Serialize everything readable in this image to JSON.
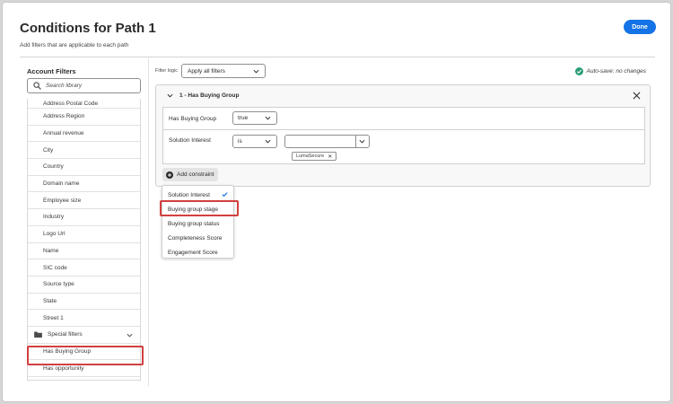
{
  "dialog": {
    "title": "Conditions for Path 1",
    "subtitle": "Add filters that are applicable to each path",
    "done_label": "Done"
  },
  "left_panel": {
    "title": "Account Filters",
    "search_placeholder": "Search library",
    "items": [
      "Address Postal Code",
      "Address Region",
      "Annual revenue",
      "City",
      "Country",
      "Domain name",
      "Employee size",
      "Industry",
      "Logo Url",
      "Name",
      "SIC code",
      "Source type",
      "State",
      "Street 1"
    ],
    "folder_label": "Special filters",
    "special_items": [
      "Has Buying Group",
      "Has opportunity"
    ]
  },
  "filter_logic": {
    "label": "Filter logic",
    "value": "Apply all filters"
  },
  "autosave": {
    "text": "Auto-save: no changes"
  },
  "card": {
    "title": "1 - Has Buying Group",
    "rows": [
      {
        "label": "Has Buying Group",
        "operator": "true"
      },
      {
        "label": "Solution Interest",
        "operator": "is",
        "value": "",
        "tags": [
          "LumaSecure"
        ]
      }
    ],
    "add_constraint_label": "Add constraint"
  },
  "constraint_menu": {
    "items": [
      {
        "label": "Solution Interest",
        "checked": true
      },
      {
        "label": "Buying group stage",
        "checked": false
      },
      {
        "label": "Buying group status",
        "checked": false
      },
      {
        "label": "Completeness Score",
        "checked": false
      },
      {
        "label": "Engagement Score",
        "checked": false
      }
    ]
  },
  "colors": {
    "primary": "#1473e6",
    "highlight": "#d23f3f",
    "success": "#2d9d78"
  }
}
